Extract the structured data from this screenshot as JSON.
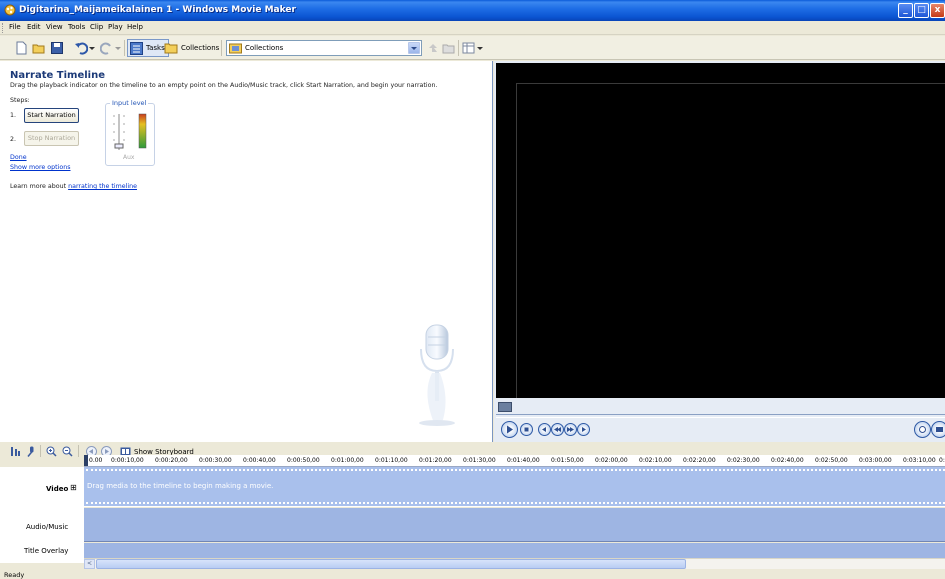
{
  "window": {
    "title": "Digitarina_Maijameikalainen 1 - Windows Movie Maker",
    "minimize": "_",
    "maximize": "□",
    "close": "x"
  },
  "menu": [
    {
      "label": "File"
    },
    {
      "label": "Edit"
    },
    {
      "label": "View"
    },
    {
      "label": "Tools"
    },
    {
      "label": "Clip"
    },
    {
      "label": "Play"
    },
    {
      "label": "Help"
    }
  ],
  "toolbar": {
    "tasks_label": "Tasks",
    "collections_label": "Collections",
    "collections_value": "Collections"
  },
  "narrate": {
    "heading": "Narrate Timeline",
    "description": "Drag the playback indicator on the timeline to an empty point on the Audio/Music track, click Start Narration, and begin your narration.",
    "steps_label": "Steps:",
    "step1_num": "1.",
    "step2_num": "2.",
    "start_button": "Start Narration",
    "stop_button": "Stop Narration",
    "input_level_label": "Input level",
    "aux_label": "Aux",
    "done_link": "Done",
    "more_options_link": "Show more options",
    "learn_more_text": "Learn more about ",
    "learn_more_link": "narrating the timeline"
  },
  "timeline": {
    "show_storyboard": "Show Storyboard",
    "ruler_ticks": [
      "0.00",
      "0:00:10,00",
      "0:00:20,00",
      "0:00:30,00",
      "0:00:40,00",
      "0:00:50,00",
      "0:01:00,00",
      "0:01:10,00",
      "0:01:20,00",
      "0:01:30,00",
      "0:01:40,00",
      "0:01:50,00",
      "0:02:00,00",
      "0:02:10,00",
      "0:02:20,00",
      "0:02:30,00",
      "0:02:40,00",
      "0:02:50,00",
      "0:03:00,00",
      "0:03:10,00",
      "0:"
    ],
    "video_label": "Video",
    "video_expand": "⊞",
    "video_message": "Drag media to the timeline to begin making a movie.",
    "audio_label": "Audio/Music",
    "title_label": "Title Overlay",
    "scroll_left": "<"
  },
  "status": "Ready"
}
